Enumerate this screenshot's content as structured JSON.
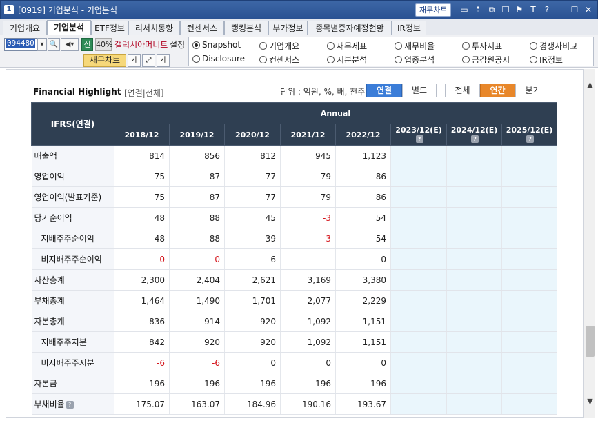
{
  "window": {
    "number": "1",
    "title": "[0919] 기업분석 - 기업분석",
    "fin_chart_button": "재무차트",
    "controls": [
      "screen-icon",
      "pin-icon",
      "copy-icon",
      "restore-icon",
      "flag-icon",
      "font-icon",
      "help-icon",
      "minimize-icon",
      "maximize-icon",
      "close-icon"
    ]
  },
  "tabs": [
    {
      "label": "기업개요",
      "active": false
    },
    {
      "label": "기업분석",
      "active": true
    },
    {
      "label": "ETF정보",
      "active": false
    },
    {
      "label": "리서치동향",
      "active": false
    },
    {
      "label": "컨센서스",
      "active": false
    },
    {
      "label": "랭킹분석",
      "active": false
    },
    {
      "label": "부가정보",
      "active": false
    },
    {
      "label": "종목별증자예정현황",
      "active": false
    },
    {
      "label": "IR정보",
      "active": false
    }
  ],
  "toolbar": {
    "stock_code": "094480",
    "new_badge": "신",
    "percent": "40%",
    "company_name": "갤럭시아머니트",
    "setting": "설정",
    "chart_button": "재무차트"
  },
  "radios": [
    {
      "label": "Snapshot",
      "selected": true
    },
    {
      "label": "기업개요",
      "selected": false
    },
    {
      "label": "재무제표",
      "selected": false
    },
    {
      "label": "재무비율",
      "selected": false
    },
    {
      "label": "투자지표",
      "selected": false
    },
    {
      "label": "경쟁사비교",
      "selected": false
    },
    {
      "label": "Disclosure",
      "selected": false
    },
    {
      "label": "컨센서스",
      "selected": false
    },
    {
      "label": "지분분석",
      "selected": false
    },
    {
      "label": "업종분석",
      "selected": false
    },
    {
      "label": "금감원공시",
      "selected": false
    },
    {
      "label": "IR정보",
      "selected": false
    }
  ],
  "highlight": {
    "title": "Financial Highlight",
    "subtitle": "[연결|전체]",
    "unit": "단위 : 억원, %, 배, 천주",
    "scope_tabs": [
      {
        "label": "연결",
        "active": true
      },
      {
        "label": "별도",
        "active": false
      }
    ],
    "period_tabs": [
      {
        "label": "전체",
        "active": false
      },
      {
        "label": "연간",
        "active": true
      },
      {
        "label": "분기",
        "active": false
      }
    ]
  },
  "table": {
    "row_header": "IFRS(연결)",
    "group_header": "Annual",
    "periods": [
      "2018/12",
      "2019/12",
      "2020/12",
      "2021/12",
      "2022/12",
      "2023/12(E)",
      "2024/12(E)",
      "2025/12(E)"
    ],
    "rows": [
      {
        "label": "매출액",
        "values": [
          "814",
          "856",
          "812",
          "945",
          "1,123",
          "",
          "",
          ""
        ]
      },
      {
        "label": "영업이익",
        "values": [
          "75",
          "87",
          "77",
          "79",
          "86",
          "",
          "",
          ""
        ]
      },
      {
        "label": "영업이익(발표기준)",
        "values": [
          "75",
          "87",
          "77",
          "79",
          "86",
          "",
          "",
          ""
        ]
      },
      {
        "label": "당기순이익",
        "values": [
          "48",
          "88",
          "45",
          "-3",
          "54",
          "",
          "",
          ""
        ]
      },
      {
        "label": "지배주주순이익",
        "values": [
          "48",
          "88",
          "39",
          "-3",
          "54",
          "",
          "",
          ""
        ]
      },
      {
        "label": "비지배주주순이익",
        "values": [
          "-0",
          "-0",
          "6",
          "",
          "0",
          "",
          "",
          ""
        ]
      },
      {
        "label": "자산총계",
        "values": [
          "2,300",
          "2,404",
          "2,621",
          "3,169",
          "3,380",
          "",
          "",
          ""
        ]
      },
      {
        "label": "부채총계",
        "values": [
          "1,464",
          "1,490",
          "1,701",
          "2,077",
          "2,229",
          "",
          "",
          ""
        ]
      },
      {
        "label": "자본총계",
        "values": [
          "836",
          "914",
          "920",
          "1,092",
          "1,151",
          "",
          "",
          ""
        ]
      },
      {
        "label": "지배주주지분",
        "values": [
          "842",
          "920",
          "920",
          "1,092",
          "1,151",
          "",
          "",
          ""
        ]
      },
      {
        "label": "비지배주주지분",
        "values": [
          "-6",
          "-6",
          "0",
          "0",
          "0",
          "",
          "",
          ""
        ]
      },
      {
        "label": "자본금",
        "values": [
          "196",
          "196",
          "196",
          "196",
          "196",
          "",
          "",
          ""
        ]
      },
      {
        "label": "부채비율",
        "values": [
          "175.07",
          "163.07",
          "184.96",
          "190.16",
          "193.67",
          "",
          "",
          ""
        ]
      }
    ]
  }
}
